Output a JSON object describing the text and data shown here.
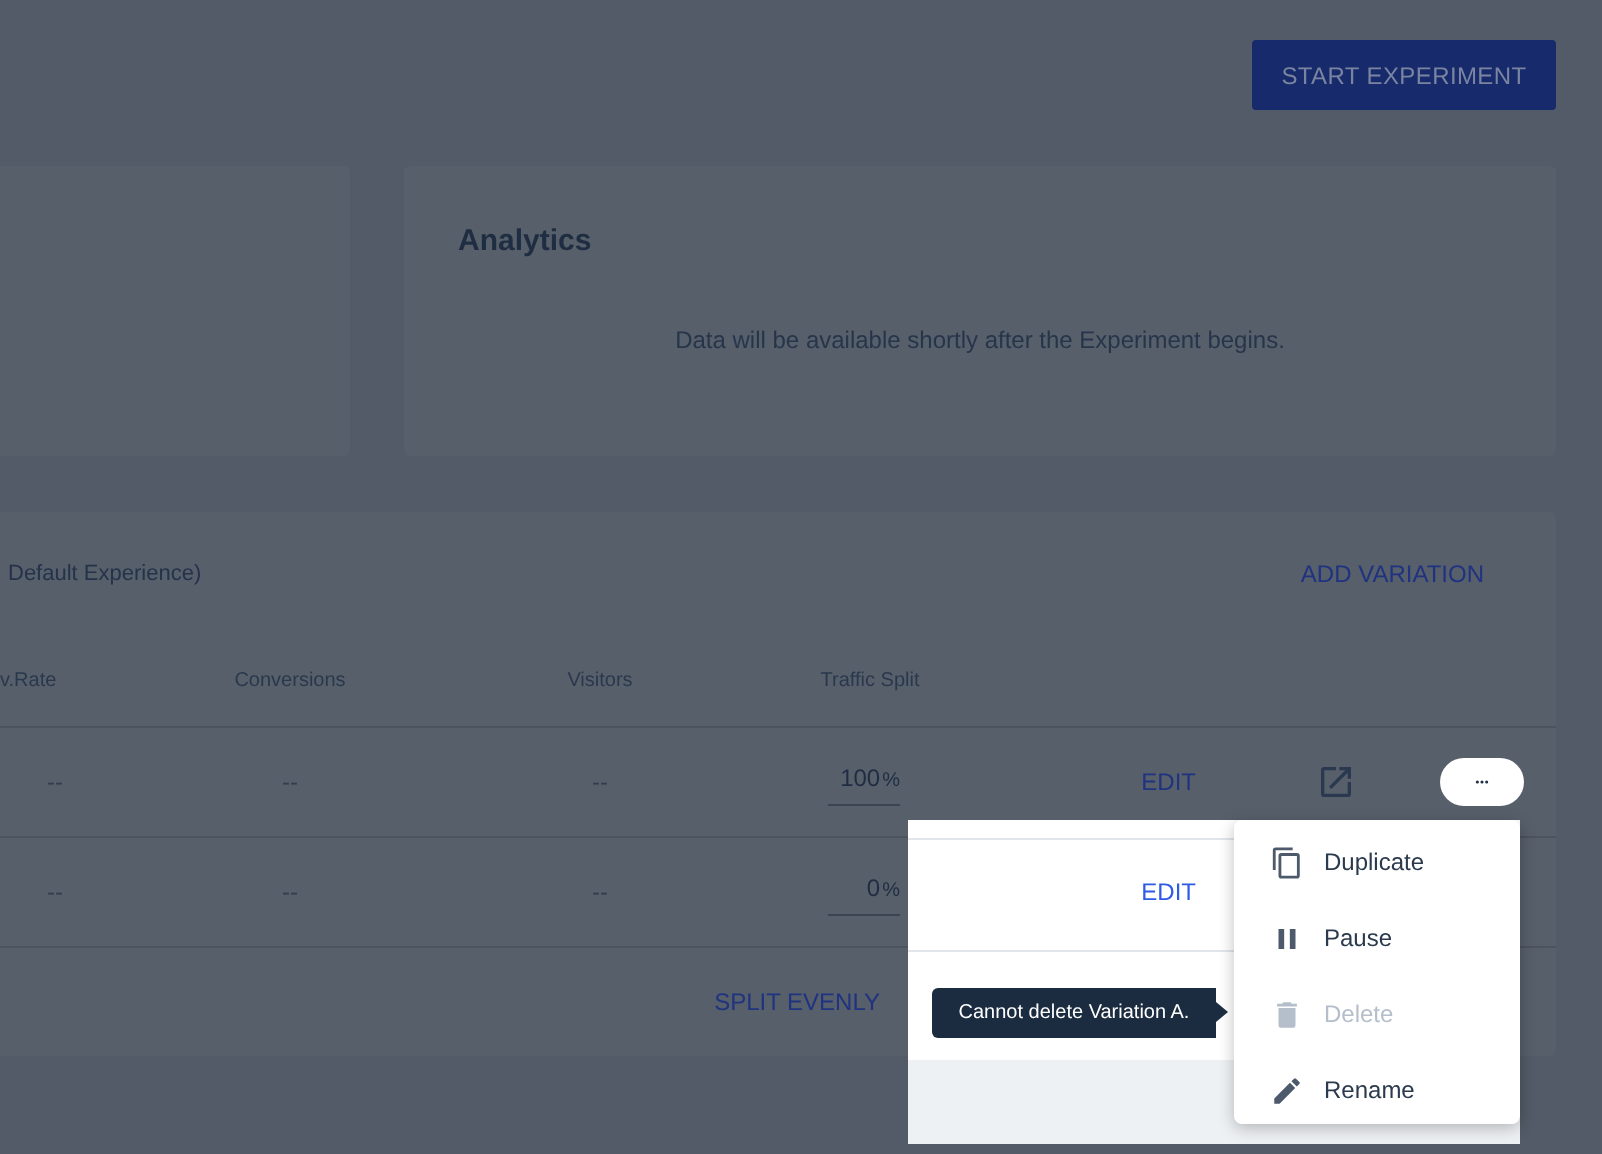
{
  "header": {
    "start_button": "START EXPERIMENT"
  },
  "analytics": {
    "title": "Analytics",
    "message": "Data will be available shortly after the Experiment begins."
  },
  "variations": {
    "title": "Default Experience)",
    "add_button": "ADD VARIATION",
    "columns": [
      "v.Rate",
      "Conversions",
      "Visitors",
      "Traffic Split"
    ],
    "rows": [
      {
        "cells": [
          "--",
          "--",
          "--"
        ],
        "traffic_split": "100",
        "unit": "%",
        "edit": "EDIT",
        "highlighted": false,
        "actions": true
      },
      {
        "cells": [
          "--",
          "--",
          "--"
        ],
        "traffic_split": "0",
        "unit": "%",
        "edit": "EDIT",
        "highlighted": true,
        "actions": false
      }
    ],
    "split_button": "SPLIT EVENLY"
  },
  "menu": {
    "items": [
      {
        "kind": "duplicate",
        "label": "Duplicate",
        "disabled": false
      },
      {
        "kind": "pause",
        "label": "Pause",
        "disabled": false
      },
      {
        "kind": "delete",
        "label": "Delete",
        "disabled": true
      },
      {
        "kind": "rename",
        "label": "Rename",
        "disabled": false
      }
    ]
  },
  "tooltip": {
    "text": "Cannot delete Variation A."
  }
}
